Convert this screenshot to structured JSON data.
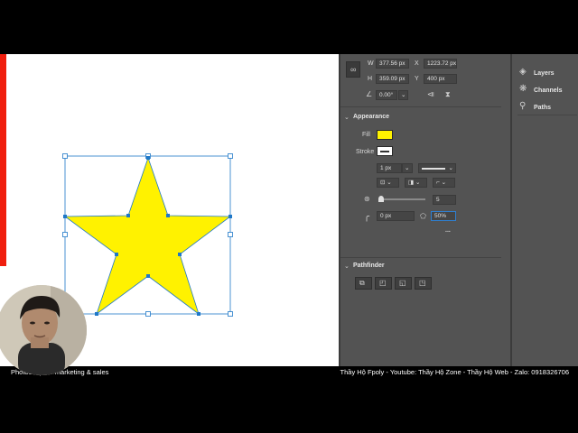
{
  "transform": {
    "w_label": "W",
    "w_value": "377.56 px",
    "x_label": "X",
    "x_value": "1223.72 px",
    "h_label": "H",
    "h_value": "359.09 px",
    "y_label": "Y",
    "y_value": "400 px",
    "angle_value": "0.00°"
  },
  "appearance": {
    "title": "Appearance",
    "fill_label": "Fill",
    "fill_color": "#fff200",
    "stroke_label": "Stroke",
    "stroke_width": "1 px",
    "points_value": "5",
    "corner_value": "0 px",
    "star_ratio_value": "50%",
    "more_label": "..."
  },
  "pathfinder": {
    "title": "Pathfinder"
  },
  "side_tabs": [
    {
      "label": "Layers",
      "icon": "layers-icon"
    },
    {
      "label": "Channels",
      "icon": "channels-icon"
    },
    {
      "label": "Paths",
      "icon": "paths-icon"
    }
  ],
  "captions": {
    "left": "Photoshop for marketing & sales",
    "right": "Thầy Hộ Fpoly - Youtube: Thầy Hộ Zone - Thầy Hộ Web - Zalo: 0918326706"
  },
  "colors": {
    "canvas": "#ffffff",
    "panel": "#535353",
    "star_fill": "#fff200",
    "accent_bar": "#f01e0e",
    "selection": "#1f78c8"
  }
}
